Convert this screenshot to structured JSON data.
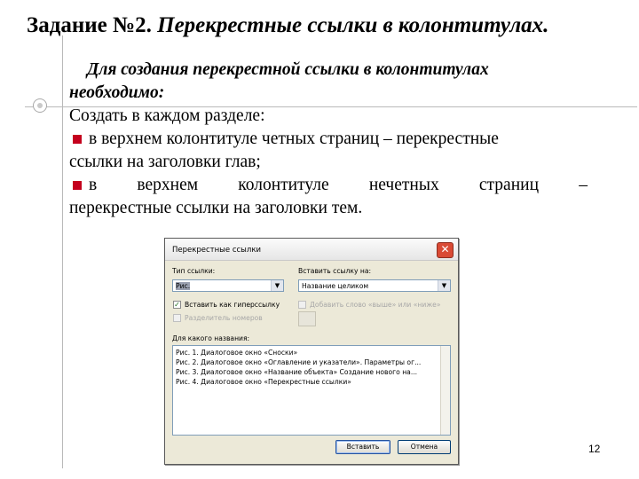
{
  "slide": {
    "title_prefix": "Задание №2.",
    "title_main": "Перекрестные ссылки в колонтитулах.",
    "intro_line1": "Для создания перекрестной ссылки в колонтитулах",
    "intro_line2": "необходимо:",
    "create_line": "Создать в каждом разделе:",
    "bullet1_line1": "в верхнем колонтитуле четных страниц – перекрестные",
    "bullet1_line2": "ссылки на заголовки глав;",
    "bullet2_words": [
      "в",
      "верхнем",
      "колонтитуле",
      "нечетных",
      "страниц",
      "–"
    ],
    "bullet2_line2": "перекрестные ссылки на заголовки тем.",
    "page_number": "12",
    "accent_color": "#c4001d"
  },
  "dialog": {
    "title": "Перекрестные ссылки",
    "ref_type_label": "Тип ссылки:",
    "ref_type_value": "Рис.",
    "insert_ref_label": "Вставить ссылку на:",
    "insert_ref_value": "Название целиком",
    "hyperlink_label": "Вставить как гиперссылку",
    "hyperlink_checked": true,
    "separate_numbers_label": "Разделитель номеров",
    "add_word_label": "Добавить слово «выше» или «ниже»",
    "for_which_label": "Для какого названия:",
    "captions": [
      "Рис. 1. Диалоговое окно «Сноски»",
      "Рис. 2. Диалоговое окно «Оглавление и указатели». Параметры ог...",
      "Рис. 3. Диалоговое окно «Название объекта» Создание нового на...",
      "Рис. 4. Диалоговое окно «Перекрестные ссылки»"
    ],
    "insert_button": "Вставить",
    "cancel_button": "Отмена"
  }
}
